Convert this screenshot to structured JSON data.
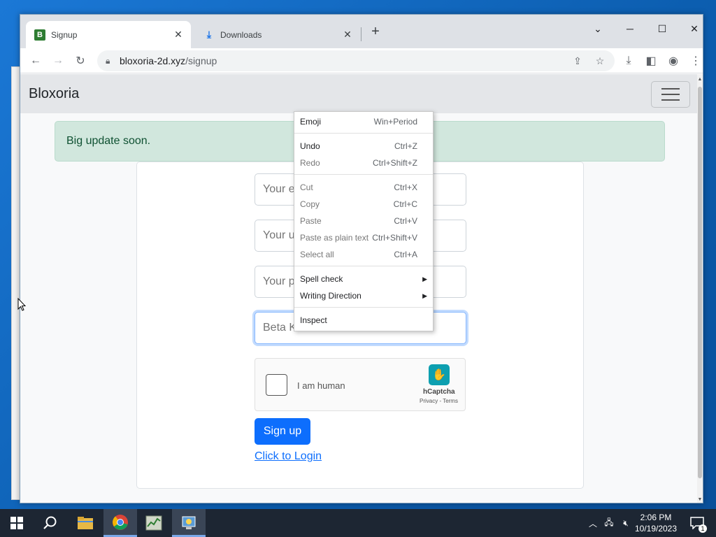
{
  "browser": {
    "tabs": [
      {
        "label": "Signup",
        "icon": "bloxoria-favicon",
        "active": true
      },
      {
        "label": "Downloads",
        "icon": "download-icon",
        "active": false
      }
    ],
    "url": {
      "host": "bloxoria-2d.xyz",
      "path": "/signup"
    }
  },
  "page": {
    "brand": "Bloxoria",
    "alert": "Big update soon.",
    "form": {
      "email_placeholder": "Your e",
      "username_placeholder": "Your u",
      "password_placeholder": "Your p",
      "beta_placeholder": "Beta K",
      "captcha_label": "I am human",
      "captcha_brand": "hCaptcha",
      "captcha_links": "Privacy - Terms",
      "signup_label": "Sign up",
      "login_link": "Click to Login"
    }
  },
  "context_menu": {
    "items": [
      {
        "label": "Emoji",
        "shortcut": "Win+Period"
      },
      {
        "label": "Undo",
        "shortcut": "Ctrl+Z"
      },
      {
        "label": "Redo",
        "shortcut": "Ctrl+Shift+Z"
      },
      {
        "label": "Cut",
        "shortcut": "Ctrl+X"
      },
      {
        "label": "Copy",
        "shortcut": "Ctrl+C"
      },
      {
        "label": "Paste",
        "shortcut": "Ctrl+V"
      },
      {
        "label": "Paste as plain text",
        "shortcut": "Ctrl+Shift+V"
      },
      {
        "label": "Select all",
        "shortcut": "Ctrl+A"
      },
      {
        "label": "Spell check",
        "shortcut": ""
      },
      {
        "label": "Writing Direction",
        "shortcut": ""
      },
      {
        "label": "Inspect",
        "shortcut": ""
      }
    ]
  },
  "taskbar": {
    "time": "2:06 PM",
    "date": "10/19/2023",
    "notification_count": "1"
  }
}
